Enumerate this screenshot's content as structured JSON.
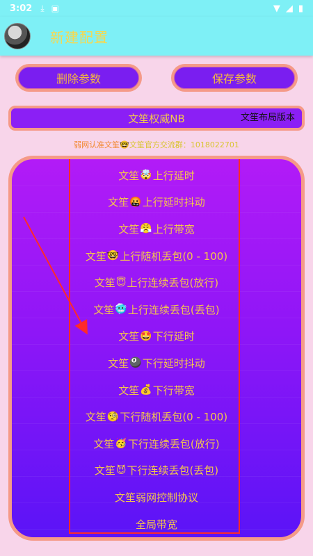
{
  "status_bar": {
    "time": "3:02",
    "icons": [
      "download-icon",
      "notification-icon",
      "wifi-icon",
      "signal-icon",
      "battery-icon"
    ]
  },
  "app_bar": {
    "title": "新建配置"
  },
  "actions": {
    "delete_label": "删除参数",
    "save_label": "保存参数"
  },
  "version": {
    "title": "文笙权威NB",
    "tag": "文笙布局版本"
  },
  "notice": {
    "prefix": "弱网认准文笙",
    "emoji": "🤓",
    "text": "文笙官方交流群：1018022701"
  },
  "menu": {
    "items": [
      {
        "prefix": "文笙",
        "emoji": "🤯",
        "label": "上行延时"
      },
      {
        "prefix": "文笙",
        "emoji": "🤬",
        "label": "上行延时抖动"
      },
      {
        "prefix": "文笙",
        "emoji": "😤",
        "label": "上行带宽"
      },
      {
        "prefix": "文笙",
        "emoji": "🤓",
        "label": "上行随机丢包(0 - 100)"
      },
      {
        "prefix": "文笙",
        "emoji": "😇",
        "label": "上行连续丢包(放行)"
      },
      {
        "prefix": "文笙",
        "emoji": "🥶",
        "label": "上行连续丢包(丢包)"
      },
      {
        "prefix": "文笙",
        "emoji": "🤩",
        "label": "下行延时"
      },
      {
        "prefix": "文笙",
        "emoji": "🎱",
        "label": "下行延时抖动"
      },
      {
        "prefix": "文笙",
        "emoji": "💰",
        "label": "下行带宽"
      },
      {
        "prefix": "文笙",
        "emoji": "🧐",
        "label": "下行随机丢包(0 - 100)"
      },
      {
        "prefix": "文笙",
        "emoji": "🥳",
        "label": "下行连续丢包(放行)"
      },
      {
        "prefix": "文笙",
        "emoji": "😈",
        "label": "下行连续丢包(丢包)"
      },
      {
        "prefix": "",
        "emoji": "",
        "label": "文笙弱网控制协议"
      },
      {
        "prefix": "",
        "emoji": "",
        "label": "全局带宽"
      }
    ]
  },
  "colors": {
    "app_bar": "#7ef0f6",
    "background": "#f8d5ea",
    "button_fill": "#7a1ef0",
    "button_border": "#f59a88",
    "text_gold": "#f4c64c",
    "annotation_red": "#ff2a2a"
  }
}
